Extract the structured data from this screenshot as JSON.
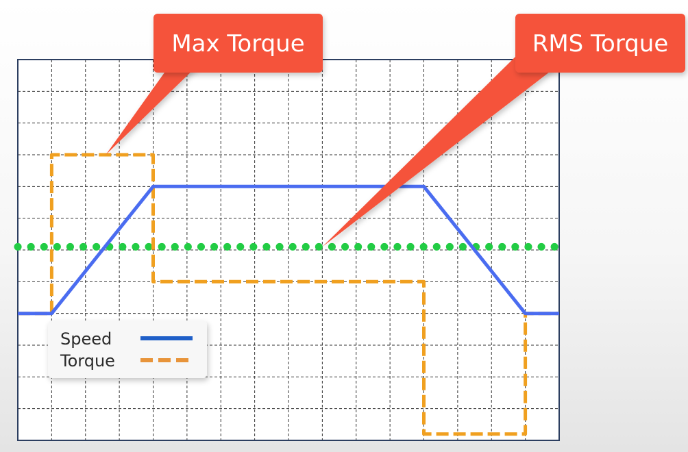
{
  "chart_data": {
    "type": "line",
    "x_grid_divisions": 16,
    "y_grid_divisions": 12,
    "grid": true,
    "grid_style": "dashed",
    "series": [
      {
        "name": "Speed",
        "style": "solid",
        "color": "#4a6cf0",
        "points": [
          [
            -1,
            4
          ],
          [
            0,
            4
          ],
          [
            3,
            8
          ],
          [
            11,
            8
          ],
          [
            14,
            4
          ],
          [
            15,
            4
          ]
        ]
      },
      {
        "name": "Torque",
        "style": "dashed",
        "color": "#f0a020",
        "points": [
          [
            -1,
            4
          ],
          [
            0,
            4
          ],
          [
            0,
            9
          ],
          [
            3,
            9
          ],
          [
            3,
            5
          ],
          [
            11,
            5
          ],
          [
            11,
            0.2
          ],
          [
            14,
            0.2
          ],
          [
            14,
            4
          ],
          [
            15,
            4
          ]
        ]
      },
      {
        "style": "dotted",
        "color": "#22cc44",
        "points": [
          [
            -1,
            6.1
          ],
          [
            15,
            6.1
          ]
        ]
      }
    ],
    "annotations": [
      {
        "text": "Max Torque",
        "target": [
          1.6,
          9
        ]
      },
      {
        "text": "RMS Torque",
        "target": [
          8,
          6.1
        ]
      }
    ],
    "legend": {
      "placement": "bottom-left",
      "items": [
        {
          "label": "Speed",
          "color": "#1f5fc8",
          "style": "solid"
        },
        {
          "label": "Torque",
          "color": "#e8943a",
          "style": "dashed"
        }
      ]
    }
  },
  "colors": {
    "callout": "#f5523a",
    "plot_border": "#2c3e60",
    "grid": "#333333"
  }
}
